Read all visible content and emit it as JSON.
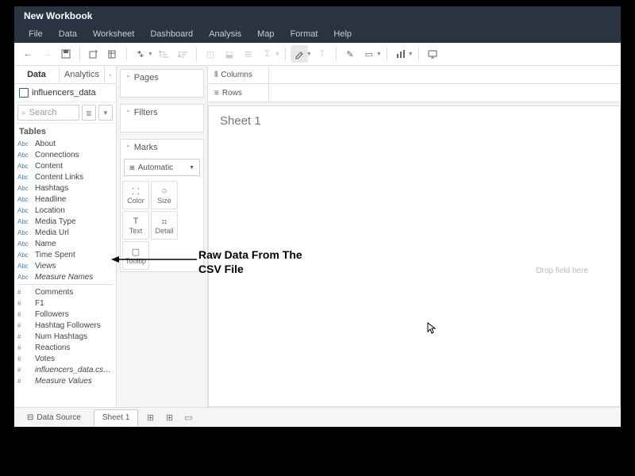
{
  "title": "New Workbook",
  "menu": [
    "File",
    "Data",
    "Worksheet",
    "Dashboard",
    "Analysis",
    "Map",
    "Format",
    "Help"
  ],
  "leftTabs": {
    "data": "Data",
    "analytics": "Analytics"
  },
  "datasource": "influencers_data",
  "search": {
    "placeholder": "Search"
  },
  "tablesHeader": "Tables",
  "dimFields": [
    {
      "t": "Abc",
      "n": "About"
    },
    {
      "t": "Abc",
      "n": "Connections"
    },
    {
      "t": "Abc",
      "n": "Content"
    },
    {
      "t": "Abc",
      "n": "Content Links"
    },
    {
      "t": "Abc",
      "n": "Hashtags"
    },
    {
      "t": "Abc",
      "n": "Headline"
    },
    {
      "t": "Abc",
      "n": "Location"
    },
    {
      "t": "Abc",
      "n": "Media Type"
    },
    {
      "t": "Abc",
      "n": "Media Url"
    },
    {
      "t": "Abc",
      "n": "Name"
    },
    {
      "t": "Abc",
      "n": "Time Spent"
    },
    {
      "t": "Abc",
      "n": "Views"
    },
    {
      "t": "Abc",
      "n": "Measure Names",
      "i": true
    }
  ],
  "measFields": [
    {
      "t": "#",
      "n": "Comments"
    },
    {
      "t": "#",
      "n": "F1"
    },
    {
      "t": "#",
      "n": "Followers"
    },
    {
      "t": "#",
      "n": "Hashtag Followers"
    },
    {
      "t": "#",
      "n": "Num Hashtags"
    },
    {
      "t": "#",
      "n": "Reactions"
    },
    {
      "t": "#",
      "n": "Votes"
    },
    {
      "t": "#",
      "n": "influencers_data.csv (C...",
      "i": true
    },
    {
      "t": "#",
      "n": "Measure Values",
      "i": true
    }
  ],
  "cards": {
    "pages": "Pages",
    "filters": "Filters",
    "marks": "Marks"
  },
  "markType": "Automatic",
  "markCells": [
    {
      "l": "Color"
    },
    {
      "l": "Size"
    },
    {
      "l": "Text"
    },
    {
      "l": "Detail"
    },
    {
      "l": "Tooltip"
    }
  ],
  "shelves": {
    "columns": "Columns",
    "rows": "Rows"
  },
  "sheetTitle": "Sheet 1",
  "dropHint": "Drop field here",
  "bottom": {
    "dataSource": "Data Source",
    "sheet": "Sheet 1"
  },
  "annotation": {
    "line1": "Raw Data From The",
    "line2": "CSV File"
  }
}
